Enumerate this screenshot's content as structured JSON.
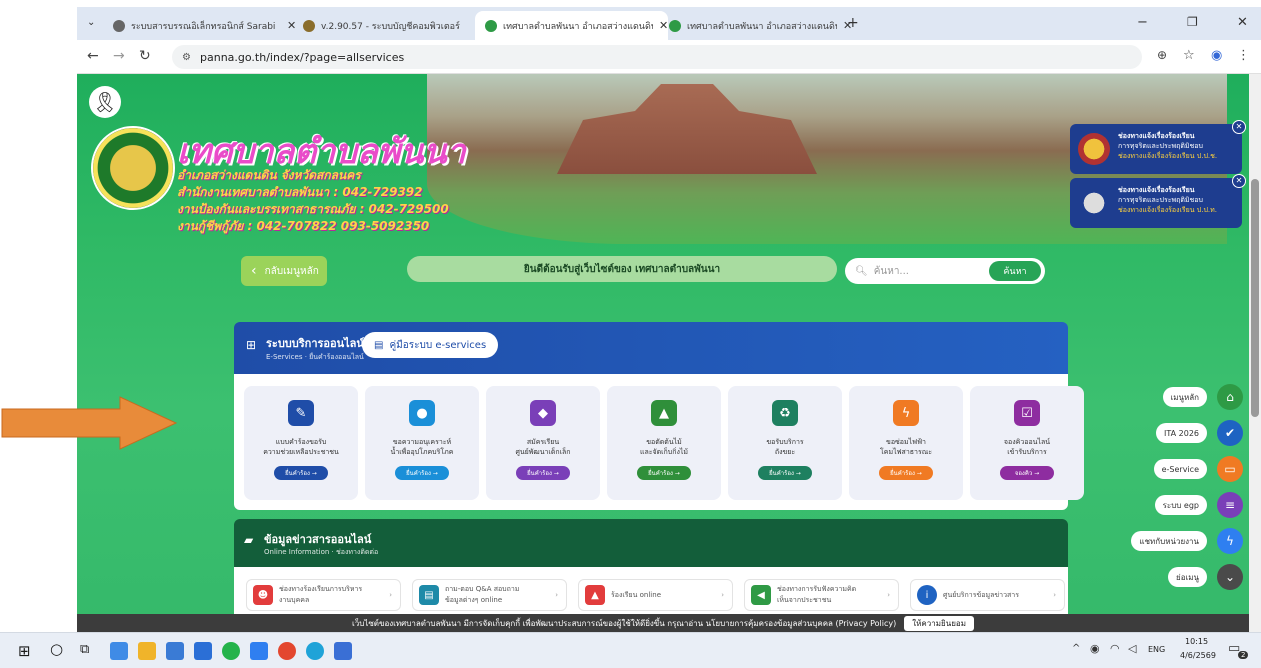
{
  "browser": {
    "tabs": [
      {
        "title": "ระบบสารบรรณอิเล็กทรอนิกส์ Sarabi",
        "active": false
      },
      {
        "title": "v.2.90.57 - ระบบบัญชีคอมพิวเตอร์",
        "active": false
      },
      {
        "title": "เทศบาลตำบลพันนา อำเภอสว่างแดนดิน",
        "active": true
      },
      {
        "title": "เทศบาลตำบลพันนา อำเภอสว่างแดนดิน",
        "active": false
      }
    ],
    "new_tab": "+",
    "url": "panna.go.th/index/?page=allservices",
    "window_controls": {
      "minimize": "−",
      "restore": "❐",
      "close": "✕"
    }
  },
  "header": {
    "title": "เทศบาลตำบลพันนา",
    "lines": [
      "อำเภอสว่างแดนดิน จังหวัดสกลนคร",
      "สำนักงานเทศบาลตำบลพันนา : 042-729392",
      "งานป้องกันและบรรเทาสาธารณภัย : 042-729500",
      "งานกู้ชีพกู้ภัย : 042-707822 093-5092350"
    ]
  },
  "notifications": [
    {
      "line1": "ช่องทางแจ้งเรื่องร้องเรียน",
      "line2": "การทุจริตและประพฤติมิชอบ",
      "line3": "ช่องทางแจ้งเรื่องร้องเรียน ป.ป.ช."
    },
    {
      "line1": "ช่องทางแจ้งเรื่องร้องเรียน",
      "line2": "การทุจริตและประพฤติมิชอบ",
      "line3": "ช่องทางแจ้งเรื่องร้องเรียน ป.ป.ท."
    }
  ],
  "toolbar": {
    "back_label": "กลับเมนูหลัก",
    "welcome": "ยินดีต้อนรับสู่เว็บไซต์ของ เทศบาลตำบลพันนา",
    "search_placeholder": "ค้นหา...",
    "search_button": "ค้นหา"
  },
  "services": {
    "title": "ระบบบริการออนไลน์",
    "subtitle": "E-Services · ยื่นคำร้องออนไลน์",
    "manual_button": "คู่มือระบบ e-services",
    "cards": [
      {
        "label1": "แบบคำร้องขอรับ",
        "label2": "ความช่วยเหลือประชาชน",
        "button": "ยื่นคำร้อง →",
        "color": "#1f4da8",
        "icon": "form-icon"
      },
      {
        "label1": "ขอความอนุเคราะห์",
        "label2": "น้ำเพื่ออุปโภคบริโภค",
        "button": "ยื่นคำร้อง →",
        "color": "#1a8fd8",
        "icon": "water-drop-icon"
      },
      {
        "label1": "สมัครเรียน",
        "label2": "ศูนย์พัฒนาเด็กเล็ก",
        "button": "ยื่นคำร้อง →",
        "color": "#7a3fb8",
        "icon": "graduation-cap-icon"
      },
      {
        "label1": "ขอตัดต้นไม้",
        "label2": "และจัดเก็บกิ่งไม้",
        "button": "ยื่นคำร้อง →",
        "color": "#2f8f3a",
        "icon": "tree-icon"
      },
      {
        "label1": "ขอรับบริการ",
        "label2": "ถังขยะ",
        "button": "ยื่นคำร้อง →",
        "color": "#1e8060",
        "icon": "recycle-icon"
      },
      {
        "label1": "ขอซ่อมไฟฟ้า",
        "label2": "โคมไฟสาธารณะ",
        "button": "ยื่นคำร้อง →",
        "color": "#f07a23",
        "icon": "lightning-icon"
      },
      {
        "label1": "จองคิวออนไลน์",
        "label2": "เข้ารับบริการ",
        "button": "จองคิว →",
        "color": "#8e2da0",
        "icon": "calendar-check-icon"
      }
    ]
  },
  "info": {
    "title": "ข้อมูลข่าวสารออนไลน์",
    "subtitle": "Online Information · ช่องทางติดต่อ",
    "items": [
      {
        "label1": "ช่องทางร้องเรียนการบริหาร",
        "label2": "งานบุคคล",
        "color": "#e23c3c",
        "icon": "people-icon"
      },
      {
        "label1": "ถาม-ตอบ Q&A สอบถาม",
        "label2": "ข้อมูลต่างๆ online",
        "color": "#1e8aa8",
        "icon": "chat-icon"
      },
      {
        "label1": "ร้องเรียน online",
        "label2": "",
        "color": "#e23c3c",
        "icon": "warning-icon"
      },
      {
        "label1": "ช่องทางการรับฟังความคิด",
        "label2": "เห็นจากประชาชน",
        "color": "#2f9a45",
        "icon": "megaphone-icon"
      },
      {
        "label1": "ศูนย์บริการข้อมูลข่าวสาร",
        "label2": "",
        "color": "#1f63c2",
        "icon": "info-icon"
      }
    ]
  },
  "side_nav": [
    {
      "label": "เมนูหลัก",
      "color": "#2e9a45",
      "icon": "home-icon"
    },
    {
      "label": "ITA 2026",
      "color": "#1e63c2",
      "icon": "check-circle-icon"
    },
    {
      "label": "e-Service",
      "color": "#f07a23",
      "icon": "monitor-icon"
    },
    {
      "label": "ระบบ egp",
      "color": "#7a3fb8",
      "icon": "list-icon"
    },
    {
      "label": "แชทกับหน่วยงาน",
      "color": "#2f7ff0",
      "icon": "messenger-icon"
    },
    {
      "label": "ย่อเมนู",
      "color": "#4a4a4a",
      "icon": "chevron-down-icon"
    }
  ],
  "cookie": {
    "text": "เว็บไซต์ของเทศบาลตำบลพันนา มีการจัดเก็บคุกกี้ เพื่อพัฒนาประสบการณ์ของผู้ใช้ให้ดียิ่งขึ้น กรุณาอ่าน นโยบายการคุ้มครองข้อมูลส่วนบุคคล (Privacy Policy)",
    "accept": "ให้ความยินยอม"
  },
  "taskbar": {
    "lang": "ENG",
    "time": "10:15",
    "date": "4/6/2569",
    "badge": "2"
  }
}
